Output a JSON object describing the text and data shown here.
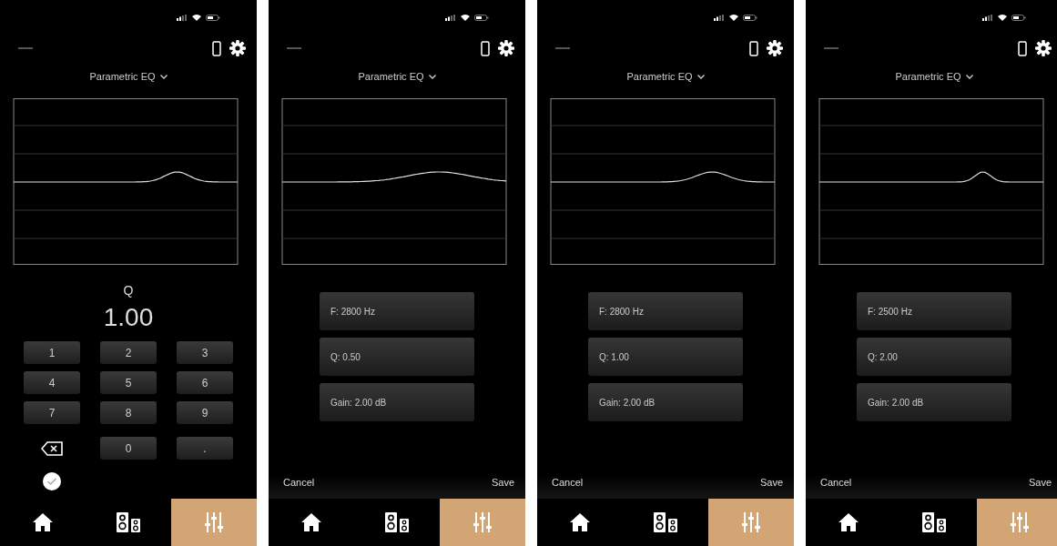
{
  "screens": [
    {
      "kind": "keypad",
      "title": "Parametric EQ",
      "field_label": "Q",
      "value": "1.00",
      "keys": [
        {
          "kind": "digit",
          "label": "1"
        },
        {
          "kind": "digit",
          "label": "2"
        },
        {
          "kind": "digit",
          "label": "3"
        },
        {
          "kind": "digit",
          "label": "4"
        },
        {
          "kind": "digit",
          "label": "5"
        },
        {
          "kind": "digit",
          "label": "6"
        },
        {
          "kind": "digit",
          "label": "7"
        },
        {
          "kind": "digit",
          "label": "8"
        },
        {
          "kind": "digit",
          "label": "9"
        },
        {
          "kind": "backspace"
        },
        {
          "kind": "digit",
          "label": "0"
        },
        {
          "kind": "digit",
          "label": "."
        },
        {
          "kind": "confirm"
        }
      ],
      "tabs": [
        {
          "kind": "home",
          "selected": false
        },
        {
          "kind": "speakers",
          "selected": false
        },
        {
          "kind": "eq",
          "selected": true
        }
      ]
    },
    {
      "kind": "params",
      "title": "Parametric EQ",
      "params": [
        "F: 2800 Hz",
        "Q: 0.50",
        "Gain: 2.00 dB"
      ],
      "cancel": "Cancel",
      "save": "Save",
      "tabs": [
        {
          "kind": "home",
          "selected": false
        },
        {
          "kind": "speakers",
          "selected": false
        },
        {
          "kind": "eq",
          "selected": true
        }
      ]
    },
    {
      "kind": "params",
      "title": "Parametric EQ",
      "params": [
        "F: 2800 Hz",
        "Q: 1.00",
        "Gain: 2.00 dB"
      ],
      "cancel": "Cancel",
      "save": "Save",
      "tabs": [
        {
          "kind": "home",
          "selected": false
        },
        {
          "kind": "speakers",
          "selected": false
        },
        {
          "kind": "eq",
          "selected": true
        }
      ]
    },
    {
      "kind": "params",
      "title": "Parametric EQ",
      "params": [
        "F: 2500 Hz",
        "Q: 2.00",
        "Gain: 2.00 dB"
      ],
      "cancel": "Cancel",
      "save": "Save",
      "tabs": [
        {
          "kind": "home",
          "selected": false
        },
        {
          "kind": "speakers",
          "selected": false
        },
        {
          "kind": "eq",
          "selected": true
        }
      ]
    }
  ]
}
